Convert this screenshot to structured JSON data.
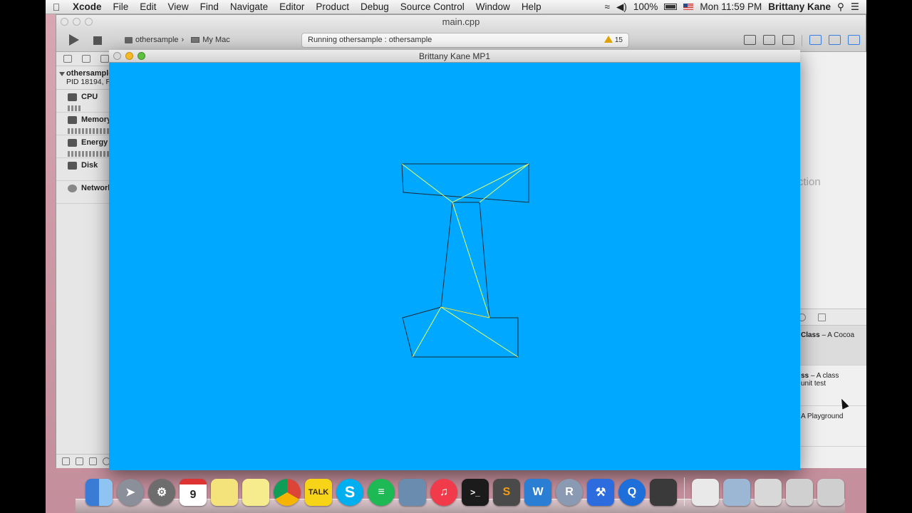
{
  "menubar": {
    "app_name": "Xcode",
    "items": [
      "File",
      "Edit",
      "View",
      "Find",
      "Navigate",
      "Editor",
      "Product",
      "Debug",
      "Source Control",
      "Window",
      "Help"
    ],
    "battery": "100%",
    "clock": "Mon 11:59 PM",
    "user": "Brittany Kane"
  },
  "xcode": {
    "title": "main.cpp",
    "scheme": "othersample",
    "destination": "My Mac",
    "activity": "Running othersample : othersample",
    "warning_count": "15",
    "debug_nav": {
      "process_name": "othersample",
      "process_pid": "PID 18194, Ru",
      "gauges": [
        "CPU",
        "Memory",
        "Energy I",
        "Disk",
        "Network"
      ]
    },
    "utility": {
      "ghost_text": "ction",
      "library_items": [
        {
          "bold": "Class",
          "text": " – A Cocoa"
        },
        {
          "bold": "ss",
          "text": " – A class",
          "line2": "unit test"
        },
        {
          "bold": "",
          "text": "A Playground"
        }
      ]
    }
  },
  "mp1": {
    "title": "Brittany Kane MP1",
    "background": "#00a9ff",
    "outline_color": "#1a2a3a",
    "diagonal_color": "#e6ff66"
  },
  "dock": {
    "calendar_day": "9",
    "talk_label": "TALK"
  }
}
